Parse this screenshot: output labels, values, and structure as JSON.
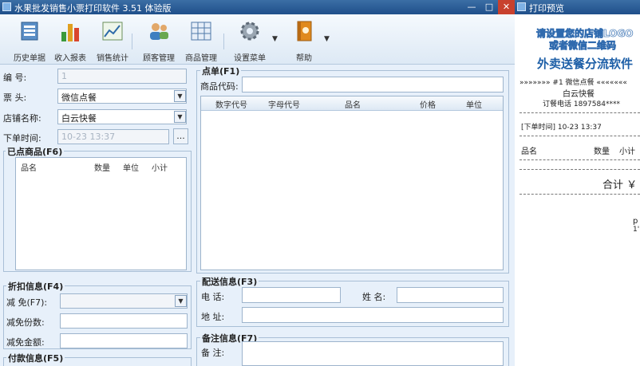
{
  "window": {
    "title": "水果批发销售小票打印软件 3.51 体验版",
    "min_glyph": "—",
    "max_glyph": "□",
    "close_glyph": "✕"
  },
  "toolbar": {
    "history": "历史单据",
    "income": "收入报表",
    "sales": "销售统计",
    "customer": "顾客管理",
    "goods": "商品管理",
    "settings": "设置菜单",
    "help": "帮助",
    "dropdown_glyph": "▼"
  },
  "form": {
    "number_label": "编 号:",
    "number_value": "1",
    "header_label": "票 头:",
    "header_value": "微信点餐",
    "shop_label": "店铺名称:",
    "shop_value": "白云快餐",
    "time_label": "下单时间:",
    "time_value": "10-23 13:37",
    "ellipsis": "...",
    "combo_glyph": "▼"
  },
  "ordered": {
    "title": "已点商品(F6)",
    "columns": [
      "品名",
      "数量",
      "单位",
      "小计"
    ]
  },
  "discount": {
    "title": "折扣信息(F4)",
    "reduce_label": "减 免(F7):",
    "share_label": "减免份数:",
    "amount_label": "减免金额:"
  },
  "payment": {
    "title": "付款信息(F5)"
  },
  "order_panel": {
    "title": "点单(F1)",
    "code_label": "商品代码:",
    "columns": [
      "数字代号",
      "字母代号",
      "品名",
      "价格",
      "单位"
    ]
  },
  "delivery": {
    "title": "配送信息(F3)",
    "phone_label": "电 话:",
    "name_label": "姓 名:",
    "address_label": "地 址:"
  },
  "note": {
    "title": "备注信息(F7)",
    "note_label": "备 注:"
  },
  "preview": {
    "title": "打印预览",
    "logo_line1": "请设置您的店铺LOGO",
    "logo_line2": "或者微信二维码",
    "slogan": "外卖送餐分流软件",
    "header_line": "»»»»»»» #1 微信点餐 «««««««",
    "shop": "白云快餐",
    "phone": "订餐电话 1897584****",
    "time": "[下单时间] 10-23 13:37",
    "col_name": "品名",
    "col_qty": "数量",
    "col_sub": "小计",
    "total": "合计 ￥",
    "stub_1": "p",
    "stub_2": "1'"
  },
  "colors": {
    "titlebar": "#2a5c96",
    "window_bg": "#e7f0fa",
    "close": "#c8412e",
    "slogan": "#1d5fa7"
  }
}
